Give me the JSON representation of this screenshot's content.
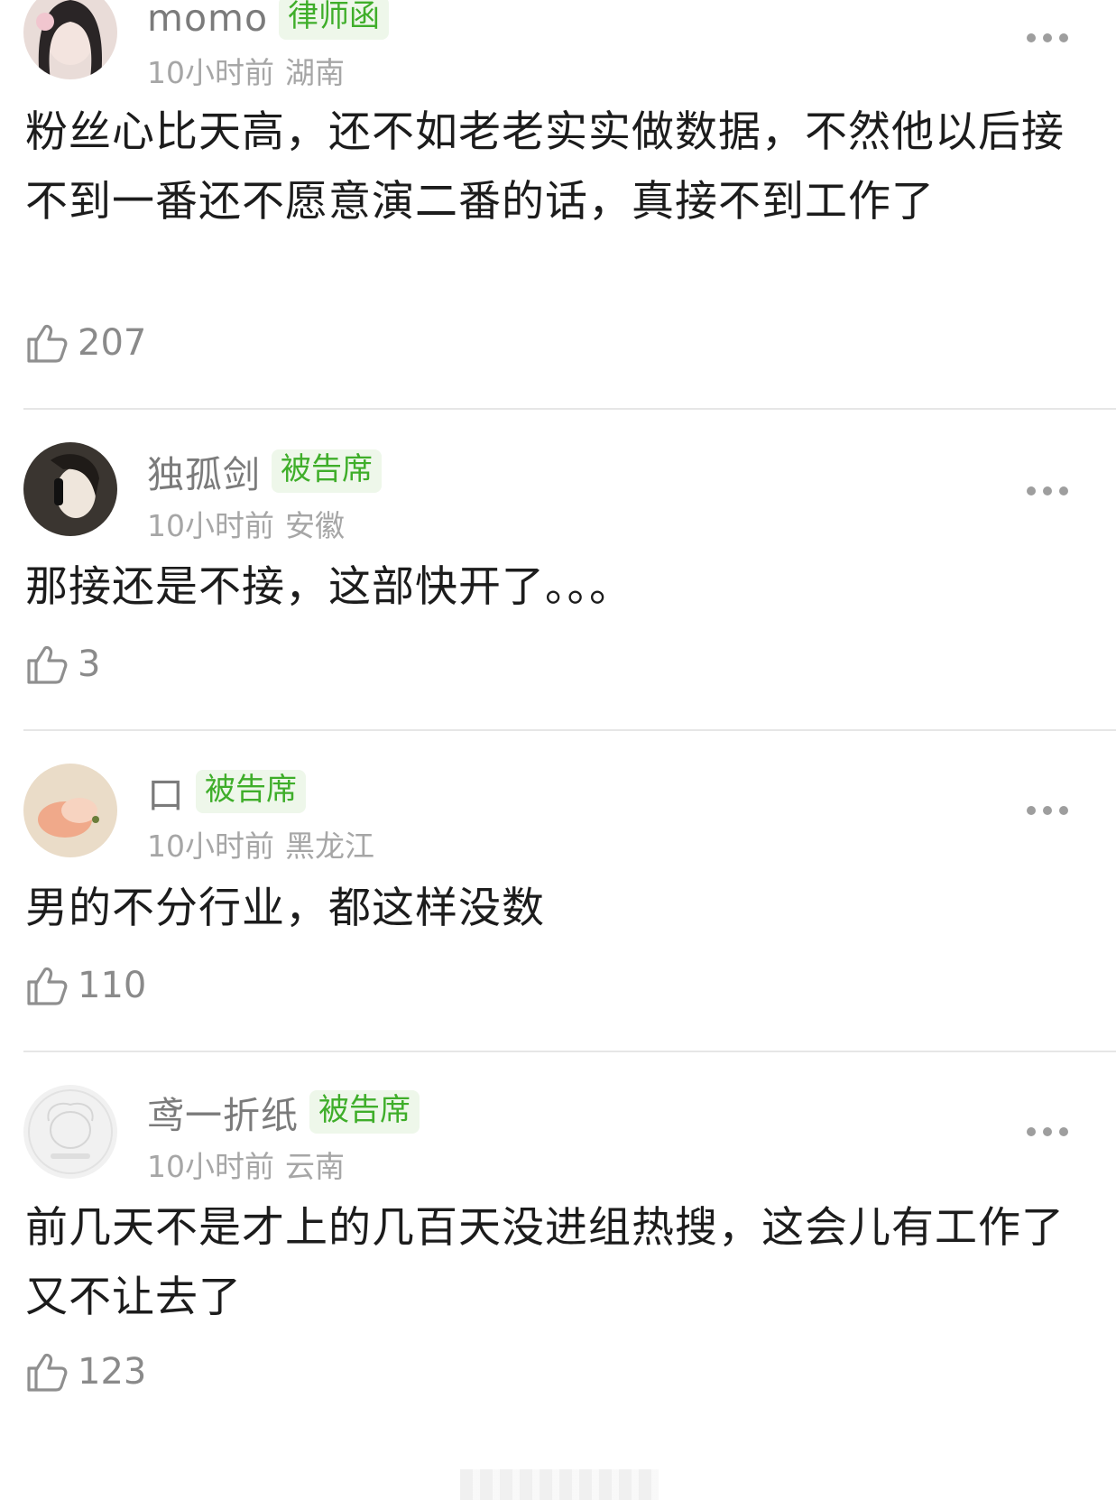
{
  "comments": [
    {
      "username": "momo",
      "badge": "律师函",
      "time": "10小时前",
      "location": "湖南",
      "text": "粉丝心比天高，还不如老老实实做数据，不然他以后接不到一番还不愿意演二番的话，真接不到工作了",
      "likes": "207"
    },
    {
      "username": "独孤剑",
      "badge": "被告席",
      "time": "10小时前",
      "location": "安徽",
      "text": "那接还是不接，这部快开了。。。",
      "likes": "3"
    },
    {
      "username": "口",
      "badge": "被告席",
      "time": "10小时前",
      "location": "黑龙江",
      "text": "男的不分行业，都这样没数",
      "likes": "110"
    },
    {
      "username": "鸢一折纸",
      "badge": "被告席",
      "time": "10小时前",
      "location": "云南",
      "text": "前几天不是才上的几百天没进组热搜，这会儿有工作了又不让去了",
      "likes": "123"
    }
  ],
  "icons": {
    "like": "thumbs-up-icon",
    "more": "more-dots-icon"
  },
  "colors": {
    "badge_text": "#3fae2a",
    "badge_bg": "#eef7ea",
    "meta": "#a6a6a6",
    "divider": "#e6e6e6"
  }
}
